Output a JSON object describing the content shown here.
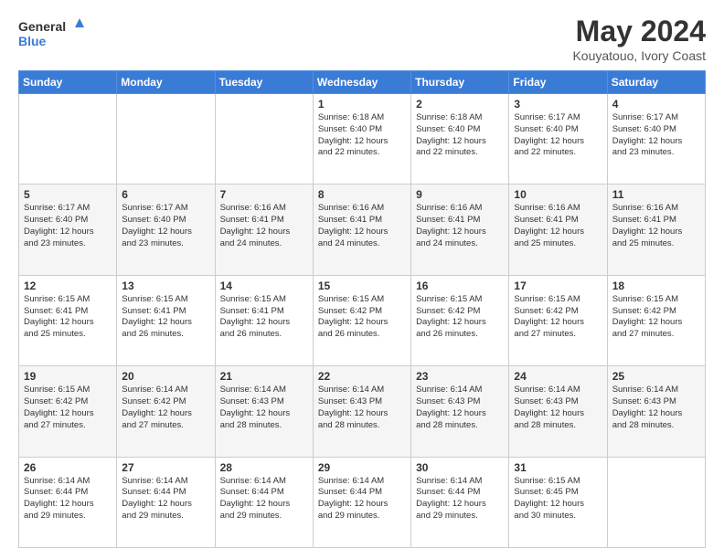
{
  "header": {
    "logo_line1": "General",
    "logo_line2": "Blue",
    "title": "May 2024",
    "subtitle": "Kouyatouo, Ivory Coast"
  },
  "days_of_week": [
    "Sunday",
    "Monday",
    "Tuesday",
    "Wednesday",
    "Thursday",
    "Friday",
    "Saturday"
  ],
  "weeks": [
    [
      {
        "day": "",
        "info": ""
      },
      {
        "day": "",
        "info": ""
      },
      {
        "day": "",
        "info": ""
      },
      {
        "day": "1",
        "info": "Sunrise: 6:18 AM\nSunset: 6:40 PM\nDaylight: 12 hours\nand 22 minutes."
      },
      {
        "day": "2",
        "info": "Sunrise: 6:18 AM\nSunset: 6:40 PM\nDaylight: 12 hours\nand 22 minutes."
      },
      {
        "day": "3",
        "info": "Sunrise: 6:17 AM\nSunset: 6:40 PM\nDaylight: 12 hours\nand 22 minutes."
      },
      {
        "day": "4",
        "info": "Sunrise: 6:17 AM\nSunset: 6:40 PM\nDaylight: 12 hours\nand 23 minutes."
      }
    ],
    [
      {
        "day": "5",
        "info": "Sunrise: 6:17 AM\nSunset: 6:40 PM\nDaylight: 12 hours\nand 23 minutes."
      },
      {
        "day": "6",
        "info": "Sunrise: 6:17 AM\nSunset: 6:40 PM\nDaylight: 12 hours\nand 23 minutes."
      },
      {
        "day": "7",
        "info": "Sunrise: 6:16 AM\nSunset: 6:41 PM\nDaylight: 12 hours\nand 24 minutes."
      },
      {
        "day": "8",
        "info": "Sunrise: 6:16 AM\nSunset: 6:41 PM\nDaylight: 12 hours\nand 24 minutes."
      },
      {
        "day": "9",
        "info": "Sunrise: 6:16 AM\nSunset: 6:41 PM\nDaylight: 12 hours\nand 24 minutes."
      },
      {
        "day": "10",
        "info": "Sunrise: 6:16 AM\nSunset: 6:41 PM\nDaylight: 12 hours\nand 25 minutes."
      },
      {
        "day": "11",
        "info": "Sunrise: 6:16 AM\nSunset: 6:41 PM\nDaylight: 12 hours\nand 25 minutes."
      }
    ],
    [
      {
        "day": "12",
        "info": "Sunrise: 6:15 AM\nSunset: 6:41 PM\nDaylight: 12 hours\nand 25 minutes."
      },
      {
        "day": "13",
        "info": "Sunrise: 6:15 AM\nSunset: 6:41 PM\nDaylight: 12 hours\nand 26 minutes."
      },
      {
        "day": "14",
        "info": "Sunrise: 6:15 AM\nSunset: 6:41 PM\nDaylight: 12 hours\nand 26 minutes."
      },
      {
        "day": "15",
        "info": "Sunrise: 6:15 AM\nSunset: 6:42 PM\nDaylight: 12 hours\nand 26 minutes."
      },
      {
        "day": "16",
        "info": "Sunrise: 6:15 AM\nSunset: 6:42 PM\nDaylight: 12 hours\nand 26 minutes."
      },
      {
        "day": "17",
        "info": "Sunrise: 6:15 AM\nSunset: 6:42 PM\nDaylight: 12 hours\nand 27 minutes."
      },
      {
        "day": "18",
        "info": "Sunrise: 6:15 AM\nSunset: 6:42 PM\nDaylight: 12 hours\nand 27 minutes."
      }
    ],
    [
      {
        "day": "19",
        "info": "Sunrise: 6:15 AM\nSunset: 6:42 PM\nDaylight: 12 hours\nand 27 minutes."
      },
      {
        "day": "20",
        "info": "Sunrise: 6:14 AM\nSunset: 6:42 PM\nDaylight: 12 hours\nand 27 minutes."
      },
      {
        "day": "21",
        "info": "Sunrise: 6:14 AM\nSunset: 6:43 PM\nDaylight: 12 hours\nand 28 minutes."
      },
      {
        "day": "22",
        "info": "Sunrise: 6:14 AM\nSunset: 6:43 PM\nDaylight: 12 hours\nand 28 minutes."
      },
      {
        "day": "23",
        "info": "Sunrise: 6:14 AM\nSunset: 6:43 PM\nDaylight: 12 hours\nand 28 minutes."
      },
      {
        "day": "24",
        "info": "Sunrise: 6:14 AM\nSunset: 6:43 PM\nDaylight: 12 hours\nand 28 minutes."
      },
      {
        "day": "25",
        "info": "Sunrise: 6:14 AM\nSunset: 6:43 PM\nDaylight: 12 hours\nand 28 minutes."
      }
    ],
    [
      {
        "day": "26",
        "info": "Sunrise: 6:14 AM\nSunset: 6:44 PM\nDaylight: 12 hours\nand 29 minutes."
      },
      {
        "day": "27",
        "info": "Sunrise: 6:14 AM\nSunset: 6:44 PM\nDaylight: 12 hours\nand 29 minutes."
      },
      {
        "day": "28",
        "info": "Sunrise: 6:14 AM\nSunset: 6:44 PM\nDaylight: 12 hours\nand 29 minutes."
      },
      {
        "day": "29",
        "info": "Sunrise: 6:14 AM\nSunset: 6:44 PM\nDaylight: 12 hours\nand 29 minutes."
      },
      {
        "day": "30",
        "info": "Sunrise: 6:14 AM\nSunset: 6:44 PM\nDaylight: 12 hours\nand 29 minutes."
      },
      {
        "day": "31",
        "info": "Sunrise: 6:15 AM\nSunset: 6:45 PM\nDaylight: 12 hours\nand 30 minutes."
      },
      {
        "day": "",
        "info": ""
      }
    ]
  ]
}
